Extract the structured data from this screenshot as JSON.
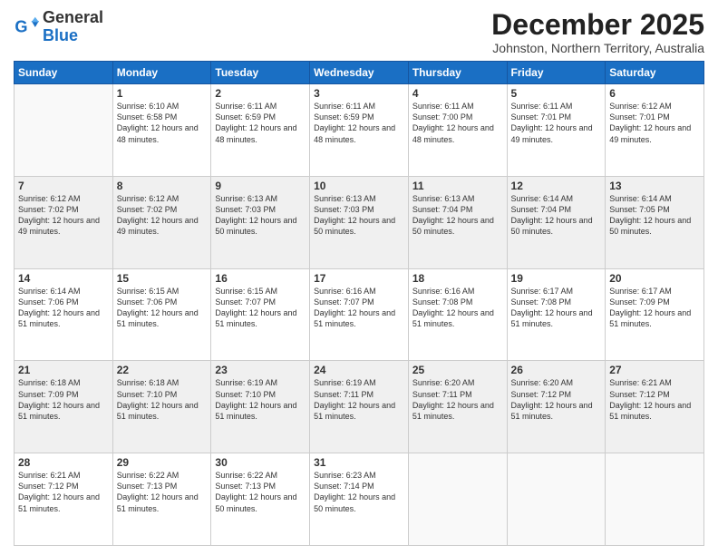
{
  "logo": {
    "general": "General",
    "blue": "Blue"
  },
  "title": "December 2025",
  "location": "Johnston, Northern Territory, Australia",
  "days_header": [
    "Sunday",
    "Monday",
    "Tuesday",
    "Wednesday",
    "Thursday",
    "Friday",
    "Saturday"
  ],
  "weeks": [
    [
      {
        "day": "",
        "empty": true
      },
      {
        "day": "1",
        "sunrise": "6:10 AM",
        "sunset": "6:58 PM",
        "daylight": "12 hours and 48 minutes."
      },
      {
        "day": "2",
        "sunrise": "6:11 AM",
        "sunset": "6:59 PM",
        "daylight": "12 hours and 48 minutes."
      },
      {
        "day": "3",
        "sunrise": "6:11 AM",
        "sunset": "6:59 PM",
        "daylight": "12 hours and 48 minutes."
      },
      {
        "day": "4",
        "sunrise": "6:11 AM",
        "sunset": "7:00 PM",
        "daylight": "12 hours and 48 minutes."
      },
      {
        "day": "5",
        "sunrise": "6:11 AM",
        "sunset": "7:01 PM",
        "daylight": "12 hours and 49 minutes."
      },
      {
        "day": "6",
        "sunrise": "6:12 AM",
        "sunset": "7:01 PM",
        "daylight": "12 hours and 49 minutes."
      }
    ],
    [
      {
        "day": "7",
        "sunrise": "6:12 AM",
        "sunset": "7:02 PM",
        "daylight": "12 hours and 49 minutes."
      },
      {
        "day": "8",
        "sunrise": "6:12 AM",
        "sunset": "7:02 PM",
        "daylight": "12 hours and 49 minutes."
      },
      {
        "day": "9",
        "sunrise": "6:13 AM",
        "sunset": "7:03 PM",
        "daylight": "12 hours and 50 minutes."
      },
      {
        "day": "10",
        "sunrise": "6:13 AM",
        "sunset": "7:03 PM",
        "daylight": "12 hours and 50 minutes."
      },
      {
        "day": "11",
        "sunrise": "6:13 AM",
        "sunset": "7:04 PM",
        "daylight": "12 hours and 50 minutes."
      },
      {
        "day": "12",
        "sunrise": "6:14 AM",
        "sunset": "7:04 PM",
        "daylight": "12 hours and 50 minutes."
      },
      {
        "day": "13",
        "sunrise": "6:14 AM",
        "sunset": "7:05 PM",
        "daylight": "12 hours and 50 minutes."
      }
    ],
    [
      {
        "day": "14",
        "sunrise": "6:14 AM",
        "sunset": "7:06 PM",
        "daylight": "12 hours and 51 minutes."
      },
      {
        "day": "15",
        "sunrise": "6:15 AM",
        "sunset": "7:06 PM",
        "daylight": "12 hours and 51 minutes."
      },
      {
        "day": "16",
        "sunrise": "6:15 AM",
        "sunset": "7:07 PM",
        "daylight": "12 hours and 51 minutes."
      },
      {
        "day": "17",
        "sunrise": "6:16 AM",
        "sunset": "7:07 PM",
        "daylight": "12 hours and 51 minutes."
      },
      {
        "day": "18",
        "sunrise": "6:16 AM",
        "sunset": "7:08 PM",
        "daylight": "12 hours and 51 minutes."
      },
      {
        "day": "19",
        "sunrise": "6:17 AM",
        "sunset": "7:08 PM",
        "daylight": "12 hours and 51 minutes."
      },
      {
        "day": "20",
        "sunrise": "6:17 AM",
        "sunset": "7:09 PM",
        "daylight": "12 hours and 51 minutes."
      }
    ],
    [
      {
        "day": "21",
        "sunrise": "6:18 AM",
        "sunset": "7:09 PM",
        "daylight": "12 hours and 51 minutes."
      },
      {
        "day": "22",
        "sunrise": "6:18 AM",
        "sunset": "7:10 PM",
        "daylight": "12 hours and 51 minutes."
      },
      {
        "day": "23",
        "sunrise": "6:19 AM",
        "sunset": "7:10 PM",
        "daylight": "12 hours and 51 minutes."
      },
      {
        "day": "24",
        "sunrise": "6:19 AM",
        "sunset": "7:11 PM",
        "daylight": "12 hours and 51 minutes."
      },
      {
        "day": "25",
        "sunrise": "6:20 AM",
        "sunset": "7:11 PM",
        "daylight": "12 hours and 51 minutes."
      },
      {
        "day": "26",
        "sunrise": "6:20 AM",
        "sunset": "7:12 PM",
        "daylight": "12 hours and 51 minutes."
      },
      {
        "day": "27",
        "sunrise": "6:21 AM",
        "sunset": "7:12 PM",
        "daylight": "12 hours and 51 minutes."
      }
    ],
    [
      {
        "day": "28",
        "sunrise": "6:21 AM",
        "sunset": "7:12 PM",
        "daylight": "12 hours and 51 minutes."
      },
      {
        "day": "29",
        "sunrise": "6:22 AM",
        "sunset": "7:13 PM",
        "daylight": "12 hours and 51 minutes."
      },
      {
        "day": "30",
        "sunrise": "6:22 AM",
        "sunset": "7:13 PM",
        "daylight": "12 hours and 50 minutes."
      },
      {
        "day": "31",
        "sunrise": "6:23 AM",
        "sunset": "7:14 PM",
        "daylight": "12 hours and 50 minutes."
      },
      {
        "day": "",
        "empty": true
      },
      {
        "day": "",
        "empty": true
      },
      {
        "day": "",
        "empty": true
      }
    ]
  ]
}
